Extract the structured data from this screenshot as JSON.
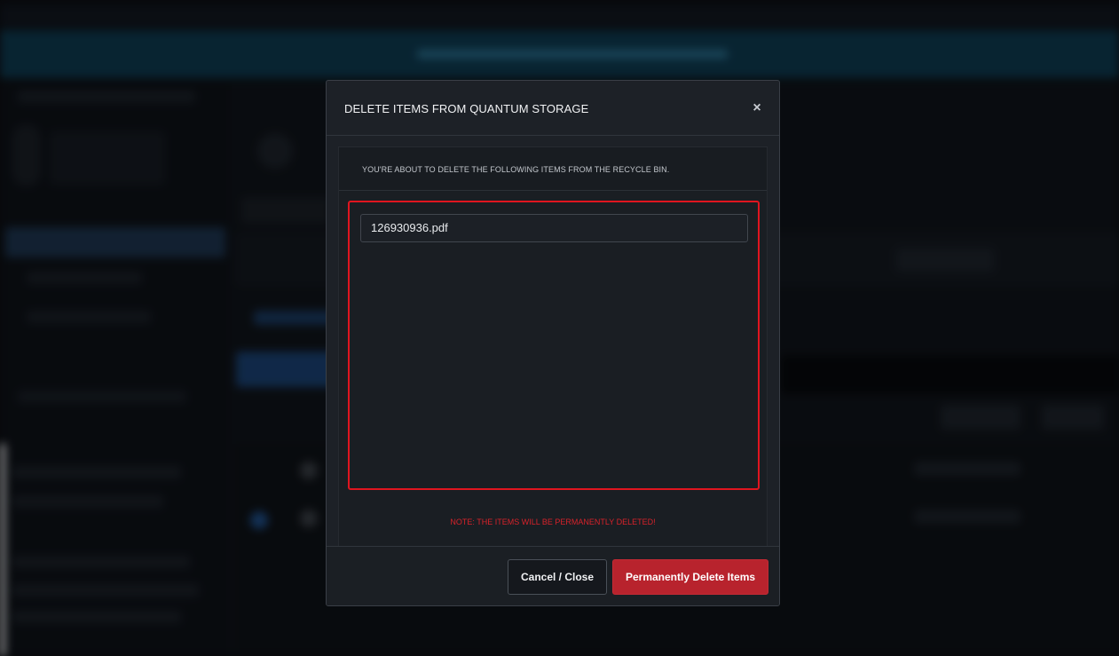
{
  "modal": {
    "title": "DELETE ITEMS FROM QUANTUM STORAGE",
    "close_symbol": "×",
    "intro": "YOU'RE ABOUT TO DELETE THE FOLLOWING ITEMS FROM THE RECYCLE BIN.",
    "items": [
      {
        "name": "126930936.pdf"
      }
    ],
    "note": "NOTE: THE ITEMS WILL BE PERMANENTLY DELETED!",
    "buttons": {
      "cancel": "Cancel / Close",
      "delete": "Permanently Delete Items"
    }
  },
  "colors": {
    "danger": "#b8232d",
    "highlight_border": "#e0151f",
    "note_text": "#d8222a",
    "modal_bg": "#1d2127"
  },
  "icons": {
    "close": "close-icon"
  }
}
